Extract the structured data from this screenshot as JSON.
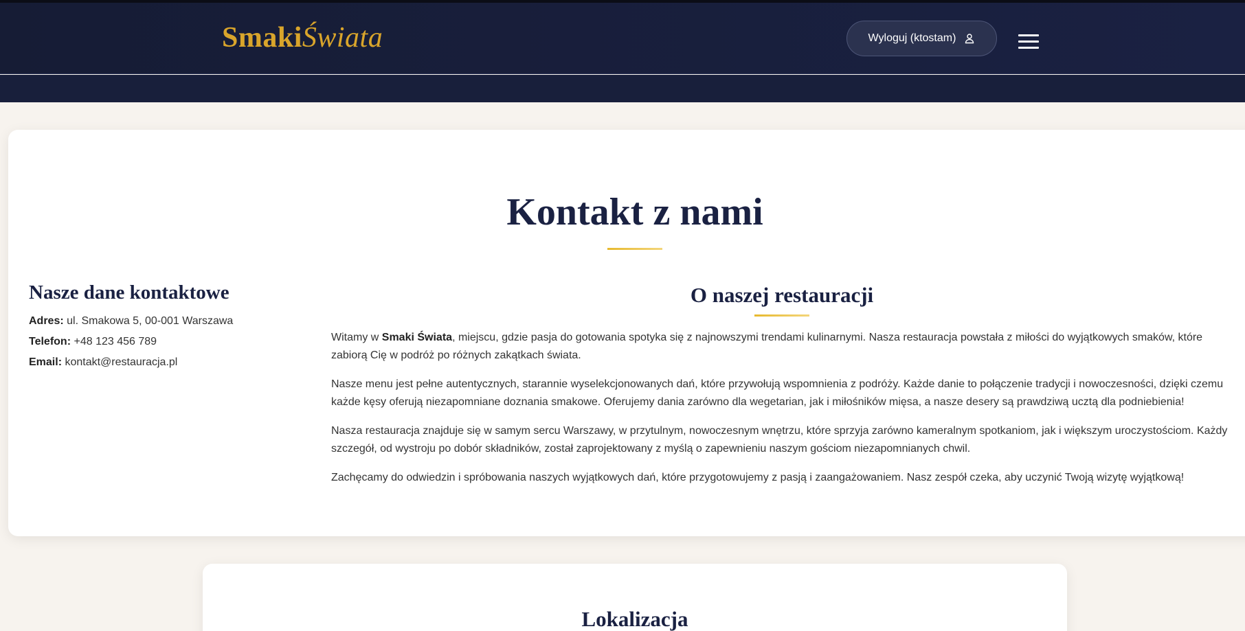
{
  "header": {
    "logo_part1": "Smaki",
    "logo_part2": "Świata",
    "logout_label": "Wyloguj (ktostam)",
    "user_icon": "user-icon",
    "menu_icon": "hamburger-menu-icon"
  },
  "colors": {
    "header_bg": "#1a2142",
    "accent_gold": "#d9a52b",
    "title_navy": "#1a2142",
    "page_bg": "#f7f3ee"
  },
  "main": {
    "title": "Kontakt z nami"
  },
  "contact": {
    "heading": "Nasze dane kontaktowe",
    "address_label": "Adres:",
    "address_value": " ul. Smakowa 5, 00-001 Warszawa",
    "phone_label": "Telefon:",
    "phone_value": " +48 123 456 789",
    "email_label": "Email:",
    "email_value": " kontakt@restauracja.pl"
  },
  "about": {
    "heading": "O naszej restauracji",
    "p1_before": "Witamy w ",
    "p1_bold": "Smaki Świata",
    "p1_after": ", miejscu, gdzie pasja do gotowania spotyka się z najnowszymi trendami kulinarnymi. Nasza restauracja powstała z miłości do wyjątkowych smaków, które zabiorą Cię w podróż po różnych zakątkach świata.",
    "p2": "Nasze menu jest pełne autentycznych, starannie wyselekcjonowanych dań, które przywołują wspomnienia z podróży. Każde danie to połączenie tradycji i nowoczesności, dzięki czemu każde kęsy oferują niezapomniane doznania smakowe. Oferujemy dania zarówno dla wegetarian, jak i miłośników mięsa, a nasze desery są prawdziwą ucztą dla podniebienia!",
    "p3": "Nasza restauracja znajduje się w samym sercu Warszawy, w przytulnym, nowoczesnym wnętrzu, które sprzyja zarówno kameralnym spotkaniom, jak i większym uroczystościom. Każdy szczegół, od wystroju po dobór składników, został zaprojektowany z myślą o zapewnieniu naszym gościom niezapomnianych chwil.",
    "p4": "Zachęcamy do odwiedzin i spróbowania naszych wyjątkowych dań, które przygotowujemy z pasją i zaangażowaniem. Nasz zespół czeka, aby uczynić Twoją wizytę wyjątkową!"
  },
  "location": {
    "heading": "Lokalizacja"
  }
}
